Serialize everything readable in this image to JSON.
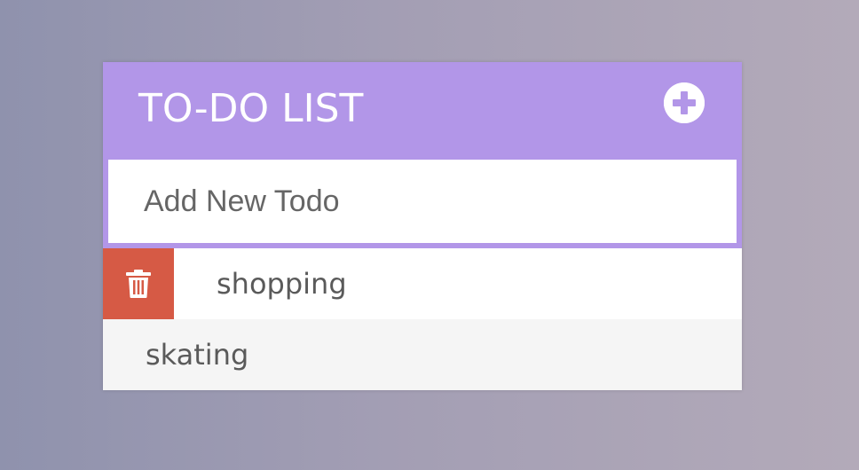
{
  "app": {
    "title": "TO-DO LIST",
    "accent_color": "#b296e8",
    "delete_color": "#d65a45"
  },
  "header": {
    "title": "TO-DO LIST",
    "add_icon": "plus-circle-icon"
  },
  "new_todo": {
    "placeholder": "Add New Todo",
    "value": ""
  },
  "todos": [
    {
      "text": "shopping",
      "delete_visible": true,
      "delete_icon": "trash-icon"
    },
    {
      "text": "skating",
      "delete_visible": false
    }
  ]
}
